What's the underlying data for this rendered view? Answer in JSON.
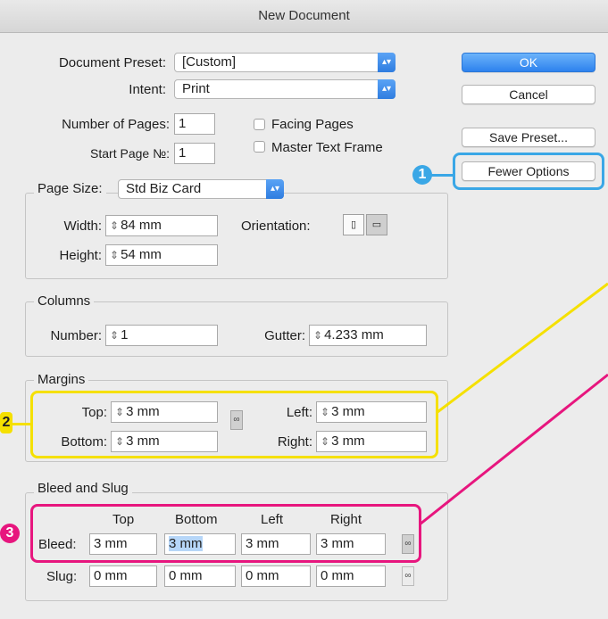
{
  "window": {
    "title": "New Document"
  },
  "preset": {
    "label": "Document Preset:",
    "value": "[Custom]"
  },
  "intent": {
    "label": "Intent:",
    "value": "Print"
  },
  "pages": {
    "label": "Number of Pages:",
    "value": "1",
    "facing_label": "Facing Pages",
    "facing_checked": false
  },
  "start_page": {
    "label": "Start Page №:",
    "value": "1",
    "master_label": "Master Text Frame",
    "master_checked": false
  },
  "buttons": {
    "ok": "OK",
    "cancel": "Cancel",
    "save_preset": "Save Preset...",
    "fewer_options": "Fewer Options"
  },
  "page_size": {
    "label": "Page Size:",
    "value": "Std Biz Card",
    "width_label": "Width:",
    "width": "84 mm",
    "height_label": "Height:",
    "height": "54 mm",
    "orientation_label": "Orientation:"
  },
  "columns": {
    "legend": "Columns",
    "number_label": "Number:",
    "number": "1",
    "gutter_label": "Gutter:",
    "gutter": "4.233 mm"
  },
  "margins": {
    "legend": "Margins",
    "top_label": "Top:",
    "top": "3 mm",
    "bottom_label": "Bottom:",
    "bottom": "3 mm",
    "left_label": "Left:",
    "left": "3 mm",
    "right_label": "Right:",
    "right": "3 mm"
  },
  "bleed_slug": {
    "legend": "Bleed and Slug",
    "headers": [
      "Top",
      "Bottom",
      "Left",
      "Right"
    ],
    "bleed_label": "Bleed:",
    "bleed": [
      "3 mm",
      "3 mm",
      "3 mm",
      "3 mm"
    ],
    "slug_label": "Slug:",
    "slug": [
      "0 mm",
      "0 mm",
      "0 mm",
      "0 mm"
    ]
  },
  "callouts": {
    "one": "1",
    "two": "2",
    "three": "3"
  },
  "colors": {
    "yellow": "#f5e000",
    "pink": "#e7167e",
    "blue": "#3aa7e6",
    "accent": "#2d82ee"
  }
}
